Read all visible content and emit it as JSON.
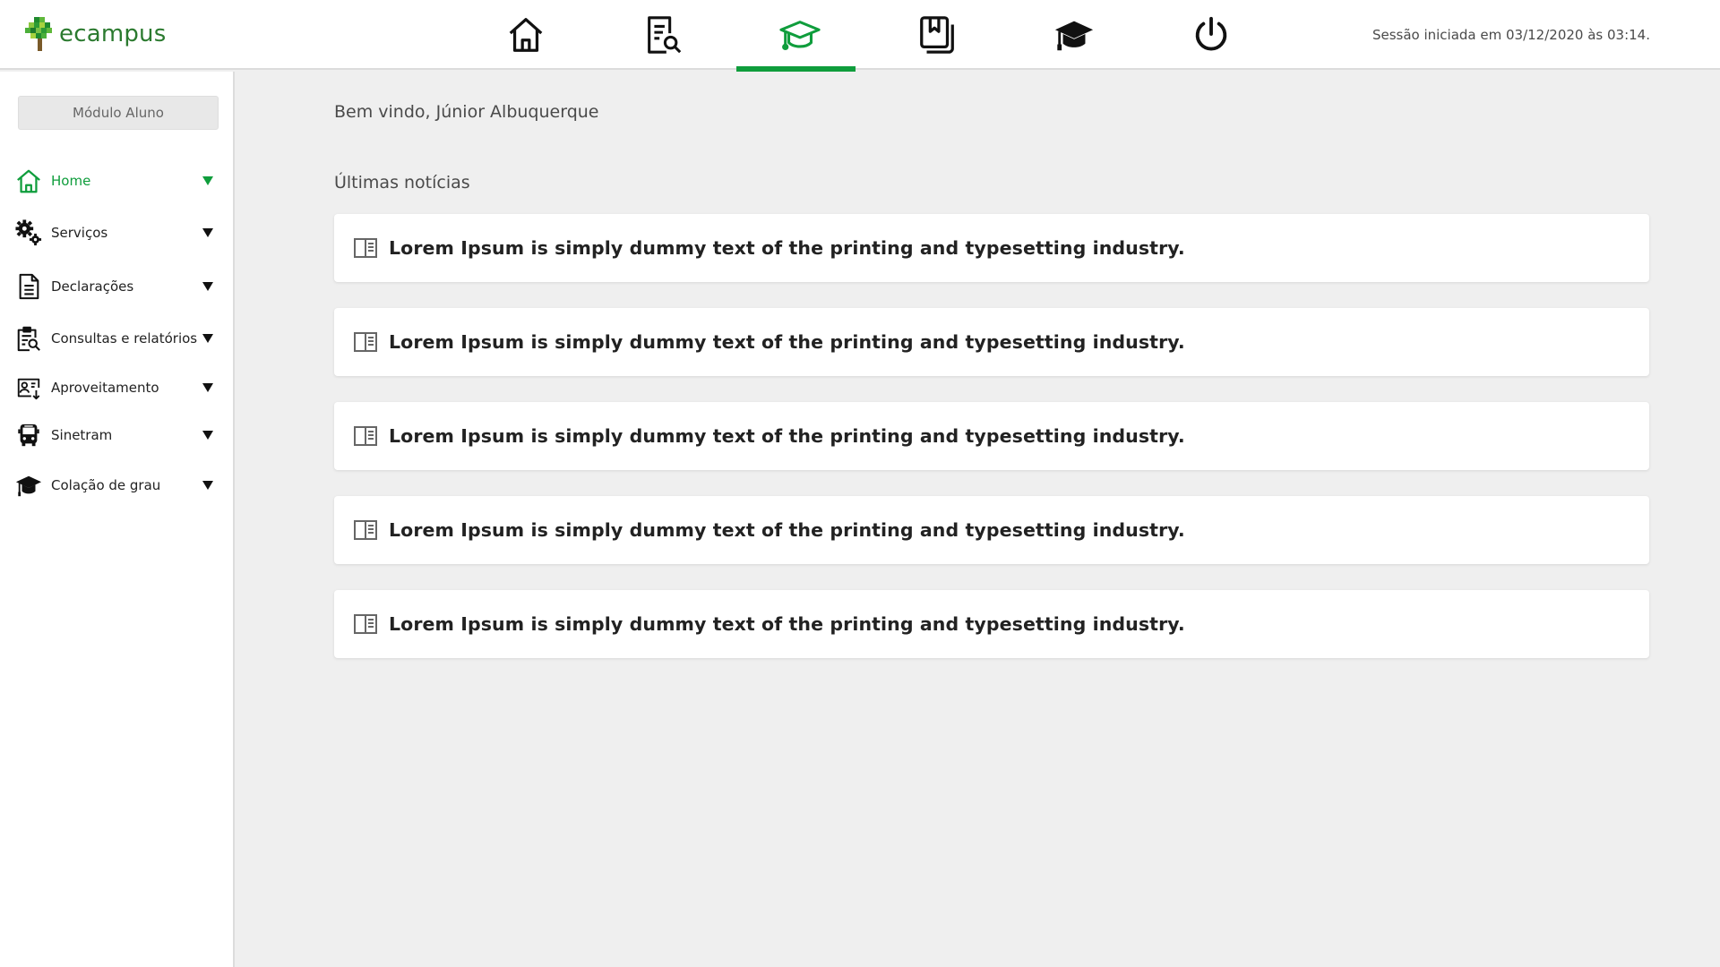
{
  "header": {
    "logo_text": "ecampus",
    "session_text": "Sessão iniciada em 03/12/2020 às 03:14.",
    "nav": [
      {
        "icon": "home-icon",
        "active": false
      },
      {
        "icon": "document-search-icon",
        "active": false
      },
      {
        "icon": "graduation-cap-outline-icon",
        "active": true
      },
      {
        "icon": "bookmark-stack-icon",
        "active": false
      },
      {
        "icon": "graduation-cap-icon",
        "active": false
      },
      {
        "icon": "power-icon",
        "active": false
      }
    ],
    "accent_color": "#0f9d3c"
  },
  "sidebar": {
    "module_label": "Módulo Aluno",
    "items": [
      {
        "label": "Home",
        "icon": "home-icon",
        "active": true
      },
      {
        "label": "Serviços",
        "icon": "gears-icon",
        "active": false
      },
      {
        "label": "Declarações",
        "icon": "document-icon",
        "active": false
      },
      {
        "label": "Consultas e relatórios",
        "icon": "clipboard-search-icon",
        "active": false
      },
      {
        "label": "Aproveitamento",
        "icon": "id-card-icon",
        "active": false
      },
      {
        "label": "Sinetram",
        "icon": "bus-icon",
        "active": false
      },
      {
        "label": "Colação de grau",
        "icon": "graduation-cap-icon",
        "active": false
      }
    ]
  },
  "main": {
    "welcome": "Bem vindo, Júnior Albuquerque",
    "news_heading": "Últimas notícias",
    "news": [
      {
        "title": "Lorem Ipsum is simply dummy text of the printing and typesetting industry.",
        "icon": "news-icon"
      },
      {
        "title": "Lorem Ipsum is simply dummy text of the printing and typesetting industry.",
        "icon": "news-icon"
      },
      {
        "title": "Lorem Ipsum is simply dummy text of the printing and typesetting industry.",
        "icon": "news-icon"
      },
      {
        "title": "Lorem Ipsum is simply dummy text of the printing and typesetting industry.",
        "icon": "news-icon"
      },
      {
        "title": "Lorem Ipsum is simply dummy text of the printing and typesetting industry.",
        "icon": "news-icon"
      }
    ]
  }
}
